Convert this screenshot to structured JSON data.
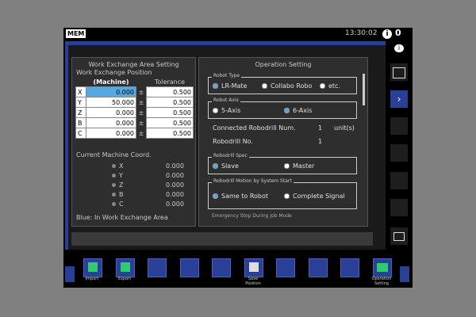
{
  "status_bar": {
    "mode": "MEM",
    "clock": "13:30:02",
    "alarm_icon": "info-icon",
    "alarm_count": "0"
  },
  "work_exchange": {
    "title": "Work Exchange Area Setting",
    "subtitle": "Work Exchange Position",
    "col_machine": "(Machine)",
    "col_tolerance": "Tolerance",
    "pm": "±",
    "rows": [
      {
        "axis": "X",
        "machine": "0.000",
        "tolerance": "0.500"
      },
      {
        "axis": "Y",
        "machine": "50.000",
        "tolerance": "0.500"
      },
      {
        "axis": "Z",
        "machine": "0.000",
        "tolerance": "0.500"
      },
      {
        "axis": "B",
        "machine": "0.000",
        "tolerance": "0.500"
      },
      {
        "axis": "C",
        "machine": "0.000",
        "tolerance": "0.500"
      }
    ],
    "coord_title": "Current Machine Coord.",
    "coords": [
      {
        "axis": "X",
        "value": "0.000"
      },
      {
        "axis": "Y",
        "value": "0.000"
      },
      {
        "axis": "Z",
        "value": "0.000"
      },
      {
        "axis": "B",
        "value": "0.000"
      },
      {
        "axis": "C",
        "value": "0.000"
      }
    ],
    "footer": "Blue: In Work Exchange Area"
  },
  "operation": {
    "title": "Operation Setting",
    "robot_type": {
      "label": "Robot Type",
      "options": [
        "LR-Mate",
        "Collabo Robo",
        "etc."
      ]
    },
    "robot_axis": {
      "label": "Robot Axis",
      "options": [
        "5-Axis",
        "6-Axis"
      ]
    },
    "connected_label": "Connected Robodrill Num.",
    "connected_value": "1",
    "connected_unit": "unit(s)",
    "robodrill_no_label": "Robodrill No.",
    "robodrill_no_value": "1",
    "robodrill_spec": {
      "label": "Robodrill Spec",
      "options": [
        "Slave",
        "Master"
      ]
    },
    "motion": {
      "label": "Robodrill Motion by System Start",
      "options": [
        "Same to Robot",
        "Complete Signal"
      ]
    },
    "cut_label": "Emergency Stop During Job Mode"
  },
  "softkeys": {
    "import": "Import",
    "export": "Export",
    "save_position": "Save\nPosition",
    "operation_setting": "Operation\nSetting"
  },
  "colors": {
    "frame": "#2a3f96",
    "selected": "#56a9e0"
  }
}
